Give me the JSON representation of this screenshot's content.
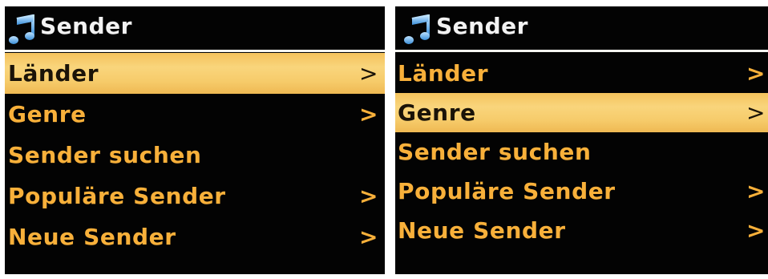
{
  "screens": [
    {
      "title": "Sender",
      "icon": "music-note-icon",
      "selected_index": 0,
      "items": [
        {
          "label": "Länder",
          "arrow": ">"
        },
        {
          "label": "Genre",
          "arrow": ">"
        },
        {
          "label": "Sender suchen",
          "arrow": ""
        },
        {
          "label": "Populäre Sender",
          "arrow": ">"
        },
        {
          "label": "Neue Sender",
          "arrow": ">"
        }
      ]
    },
    {
      "title": "Sender",
      "icon": "music-note-icon",
      "selected_index": 1,
      "items": [
        {
          "label": "Länder",
          "arrow": ">"
        },
        {
          "label": "Genre",
          "arrow": ">"
        },
        {
          "label": "Sender suchen",
          "arrow": ""
        },
        {
          "label": "Populäre Sender",
          "arrow": ">"
        },
        {
          "label": "Neue Sender",
          "arrow": ">"
        }
      ]
    }
  ],
  "colors": {
    "background": "#030303",
    "text": "#f8b03a",
    "highlight": "#f7cf72",
    "highlight_text": "#1a1308",
    "title": "#f2f2f2"
  }
}
